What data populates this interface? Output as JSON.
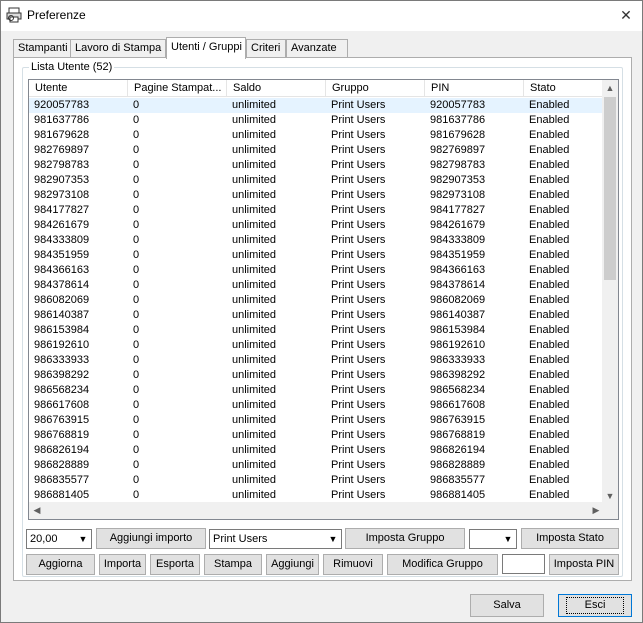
{
  "window": {
    "title": "Preferenze",
    "close_glyph": "✕"
  },
  "tabs": [
    {
      "label": "Stampanti"
    },
    {
      "label": "Lavoro di Stampa"
    },
    {
      "label": "Utenti / Gruppi",
      "active": true
    },
    {
      "label": "Criteri"
    },
    {
      "label": "Avanzate"
    }
  ],
  "group": {
    "label": "Lista Utente (52)"
  },
  "list": {
    "columns": [
      "Utente",
      "Pagine Stampat...",
      "Saldo",
      "Gruppo",
      "PIN",
      "Stato"
    ],
    "rows": [
      [
        "920057783",
        "0",
        "unlimited",
        "Print Users",
        "920057783",
        "Enabled"
      ],
      [
        "981637786",
        "0",
        "unlimited",
        "Print Users",
        "981637786",
        "Enabled"
      ],
      [
        "981679628",
        "0",
        "unlimited",
        "Print Users",
        "981679628",
        "Enabled"
      ],
      [
        "982769897",
        "0",
        "unlimited",
        "Print Users",
        "982769897",
        "Enabled"
      ],
      [
        "982798783",
        "0",
        "unlimited",
        "Print Users",
        "982798783",
        "Enabled"
      ],
      [
        "982907353",
        "0",
        "unlimited",
        "Print Users",
        "982907353",
        "Enabled"
      ],
      [
        "982973108",
        "0",
        "unlimited",
        "Print Users",
        "982973108",
        "Enabled"
      ],
      [
        "984177827",
        "0",
        "unlimited",
        "Print Users",
        "984177827",
        "Enabled"
      ],
      [
        "984261679",
        "0",
        "unlimited",
        "Print Users",
        "984261679",
        "Enabled"
      ],
      [
        "984333809",
        "0",
        "unlimited",
        "Print Users",
        "984333809",
        "Enabled"
      ],
      [
        "984351959",
        "0",
        "unlimited",
        "Print Users",
        "984351959",
        "Enabled"
      ],
      [
        "984366163",
        "0",
        "unlimited",
        "Print Users",
        "984366163",
        "Enabled"
      ],
      [
        "984378614",
        "0",
        "unlimited",
        "Print Users",
        "984378614",
        "Enabled"
      ],
      [
        "986082069",
        "0",
        "unlimited",
        "Print Users",
        "986082069",
        "Enabled"
      ],
      [
        "986140387",
        "0",
        "unlimited",
        "Print Users",
        "986140387",
        "Enabled"
      ],
      [
        "986153984",
        "0",
        "unlimited",
        "Print Users",
        "986153984",
        "Enabled"
      ],
      [
        "986192610",
        "0",
        "unlimited",
        "Print Users",
        "986192610",
        "Enabled"
      ],
      [
        "986333933",
        "0",
        "unlimited",
        "Print Users",
        "986333933",
        "Enabled"
      ],
      [
        "986398292",
        "0",
        "unlimited",
        "Print Users",
        "986398292",
        "Enabled"
      ],
      [
        "986568234",
        "0",
        "unlimited",
        "Print Users",
        "986568234",
        "Enabled"
      ],
      [
        "986617608",
        "0",
        "unlimited",
        "Print Users",
        "986617608",
        "Enabled"
      ],
      [
        "986763915",
        "0",
        "unlimited",
        "Print Users",
        "986763915",
        "Enabled"
      ],
      [
        "986768819",
        "0",
        "unlimited",
        "Print Users",
        "986768819",
        "Enabled"
      ],
      [
        "986826194",
        "0",
        "unlimited",
        "Print Users",
        "986826194",
        "Enabled"
      ],
      [
        "986828889",
        "0",
        "unlimited",
        "Print Users",
        "986828889",
        "Enabled"
      ],
      [
        "986835577",
        "0",
        "unlimited",
        "Print Users",
        "986835577",
        "Enabled"
      ],
      [
        "986881405",
        "0",
        "unlimited",
        "Print Users",
        "986881405",
        "Enabled"
      ]
    ]
  },
  "controls": {
    "amount_value": "20,00",
    "add_amount_label": "Aggiungi importo",
    "group_select_value": "Print Users",
    "set_group_label": "Imposta Gruppo",
    "status_select_value": "",
    "set_status_label": "Imposta Stato",
    "refresh_label": "Aggiorna",
    "import_label": "Importa",
    "export_label": "Esporta",
    "print_label": "Stampa",
    "add_label": "Aggiungi",
    "remove_label": "Rimuovi",
    "edit_group_label": "Modifica Gruppo",
    "pin_value": "",
    "set_pin_label": "Imposta PIN"
  },
  "footer": {
    "save_label": "Salva",
    "exit_label": "Esci"
  },
  "icons": {
    "dropdown": "▼",
    "scroll_up": "▲",
    "scroll_down": "▼",
    "scroll_left": "◀",
    "scroll_right": "▶"
  }
}
